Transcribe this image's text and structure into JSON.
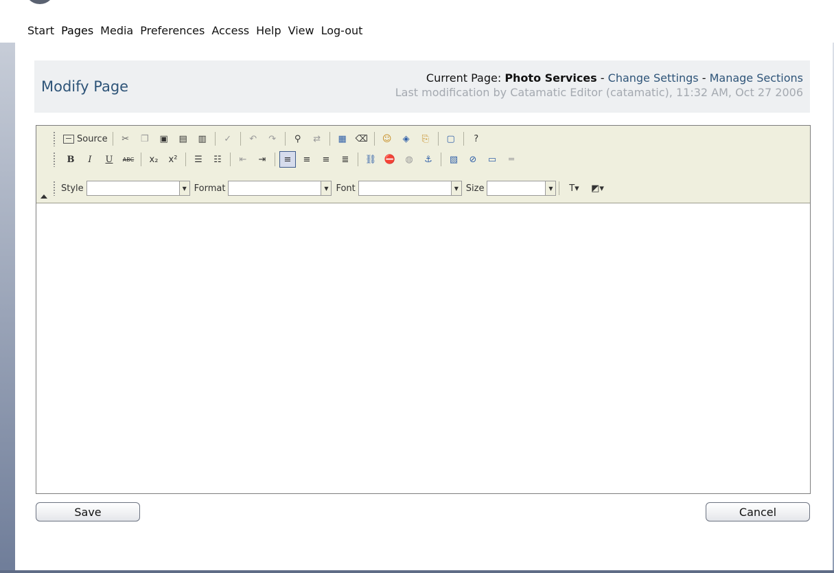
{
  "nav": {
    "items": [
      "Start",
      "Pages",
      "Media",
      "Preferences",
      "Access",
      "Help",
      "View",
      "Log-out"
    ],
    "active": "Pages"
  },
  "header": {
    "title": "Modify Page",
    "current_page_label": "Current Page:",
    "current_page_name": "Photo Services",
    "sep1": "-",
    "change_settings": "Change Settings",
    "sep2": "-",
    "manage_sections": "Manage Sections",
    "last_modification": "Last modification by Catamatic Editor (catamatic), 11:32 AM, Oct 27 2006"
  },
  "toolbar": {
    "source_label": "Source",
    "bold": "B",
    "italic": "I",
    "underline": "U",
    "strike": "ABC",
    "style_label": "Style",
    "format_label": "Format",
    "font_label": "Font",
    "size_label": "Size",
    "style_value": "",
    "format_value": "",
    "font_value": "",
    "size_value": ""
  },
  "buttons": {
    "save": "Save",
    "cancel": "Cancel"
  },
  "colors": {
    "accent": "#2e5478",
    "header_bg": "#eef0f2",
    "toolbar_bg": "#efefde"
  }
}
